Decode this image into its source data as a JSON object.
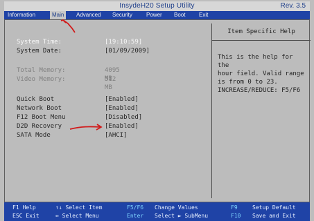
{
  "window": {
    "title": "InsydeH20 Setup Utility",
    "revision": "Rev. 3.5"
  },
  "menu": {
    "items": [
      "Information",
      "Main",
      "Advanced",
      "Security",
      "Power",
      "Boot",
      "Exit"
    ],
    "active": "Main"
  },
  "settings": [
    {
      "label": "System Time:",
      "value": "[19:10:59]"
    },
    {
      "label": "System Date:",
      "value": "[01/09/2009]"
    },
    {
      "label": "Total Memory:",
      "value": "4095 MB"
    },
    {
      "label": "Video Memory:",
      "value": "512 MB"
    },
    {
      "label": "Quick Boot",
      "value": "[Enabled]"
    },
    {
      "label": "Network Boot",
      "value": "[Enabled]"
    },
    {
      "label": "F12 Boot Menu",
      "value": "[Disabled]"
    },
    {
      "label": "D2D Recovery",
      "value": "[Enabled]"
    },
    {
      "label": "SATA Mode",
      "value": "[AHCI]"
    }
  ],
  "help": {
    "title": "Item Specific Help",
    "text": "This is the help for the\nhour field. Valid range\nis from 0 to 23.\nINCREASE/REDUCE: F5/F6"
  },
  "footer": {
    "col1": [
      "F1  Help",
      "ESC Exit"
    ],
    "col2": [
      "↑↓  Select Item",
      "↔  Select Menu"
    ],
    "col3": [
      "F5/F6",
      "Enter"
    ],
    "col4": [
      "Change Values",
      "Select ► SubMenu"
    ],
    "col5": [
      "F9",
      "F10"
    ],
    "col6": [
      "Setup Default",
      "Save and Exit"
    ]
  },
  "colors": {
    "menu_blue": "#1f43a6",
    "screen_grey": "#bdbdbd",
    "annotation_red": "#d11a1a"
  }
}
